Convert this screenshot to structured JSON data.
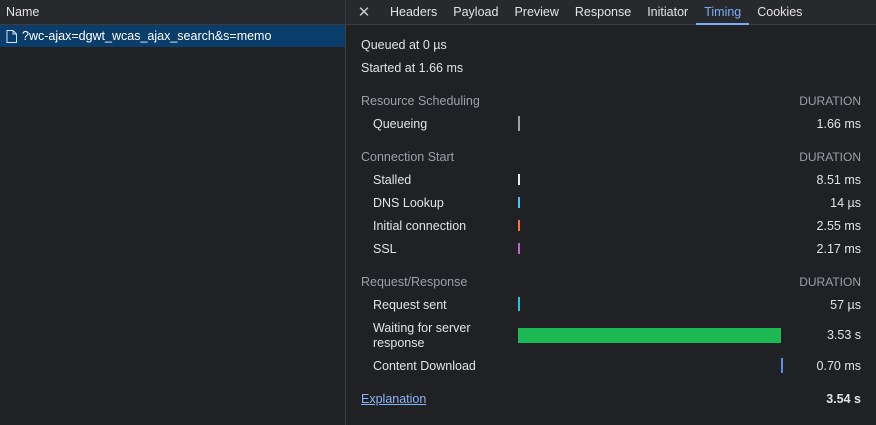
{
  "requests": {
    "header": "Name",
    "items": [
      {
        "name": "?wc-ajax=dgwt_wcas_ajax_search&s=memo"
      }
    ]
  },
  "tabs": [
    "Headers",
    "Payload",
    "Preview",
    "Response",
    "Initiator",
    "Timing",
    "Cookies"
  ],
  "active_tab": "Timing",
  "timing": {
    "queued": "Queued at 0 µs",
    "started": "Started at 1.66 ms",
    "duration_header": "DURATION",
    "sections": [
      {
        "title": "Resource Scheduling",
        "rows": [
          {
            "label": "Queueing",
            "value": "1.66 ms",
            "color": "#9aa0a6"
          }
        ]
      },
      {
        "title": "Connection Start",
        "rows": [
          {
            "label": "Stalled",
            "value": "8.51 ms",
            "color": "#e8eaed"
          },
          {
            "label": "DNS Lookup",
            "value": "14 µs",
            "color": "#4fc3f7"
          },
          {
            "label": "Initial connection",
            "value": "2.55 ms",
            "color": "#ff7043"
          },
          {
            "label": "SSL",
            "value": "2.17 ms",
            "color": "#ba68c8"
          }
        ]
      },
      {
        "title": "Request/Response",
        "rows": [
          {
            "label": "Request sent",
            "value": "57 µs",
            "color": "#26c6da"
          },
          {
            "label": "Waiting for server response",
            "value": "3.53 s",
            "color": "#1db954"
          },
          {
            "label": "Content Download",
            "value": "0.70 ms",
            "color": "#5b8def"
          }
        ]
      }
    ],
    "explanation": "Explanation",
    "total": "3.54 s"
  }
}
